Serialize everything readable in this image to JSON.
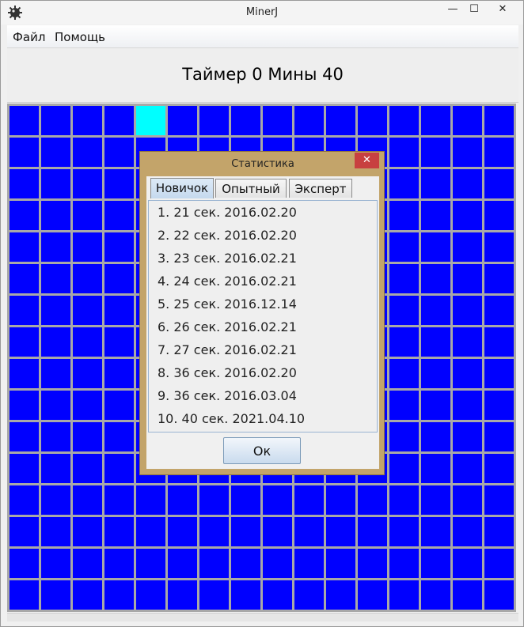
{
  "window": {
    "title": "MinerJ",
    "minimize_glyph": "—",
    "maximize_glyph": "☐",
    "close_glyph": "✕"
  },
  "menu": {
    "file": "Файл",
    "help": "Помощь"
  },
  "status": {
    "text": "Таймер 0 Мины 40"
  },
  "board": {
    "cell_color": "#0000ff",
    "highlight_color": "#00ffff",
    "grid_color": "#a8a8a8",
    "highlighted_cell": {
      "row": 0,
      "col": 4
    }
  },
  "dialog": {
    "title": "Статистика",
    "close_glyph": "✕",
    "tabs": [
      "Новичок",
      "Опытный",
      "Эксперт"
    ],
    "active_tab": 0,
    "records": [
      "1. 21 сек. 2016.02.20",
      "2. 22 сек. 2016.02.20",
      "3. 23 сек. 2016.02.21",
      "4. 24 сек. 2016.02.21",
      "5. 25 сек. 2016.12.14",
      "6. 26 сек. 2016.02.21",
      "7. 27 сек. 2016.02.21",
      "8. 36 сек. 2016.02.20",
      "9. 36 сек. 2016.03.04",
      "10. 40 сек. 2021.04.10"
    ],
    "ok_label": "Ок"
  }
}
